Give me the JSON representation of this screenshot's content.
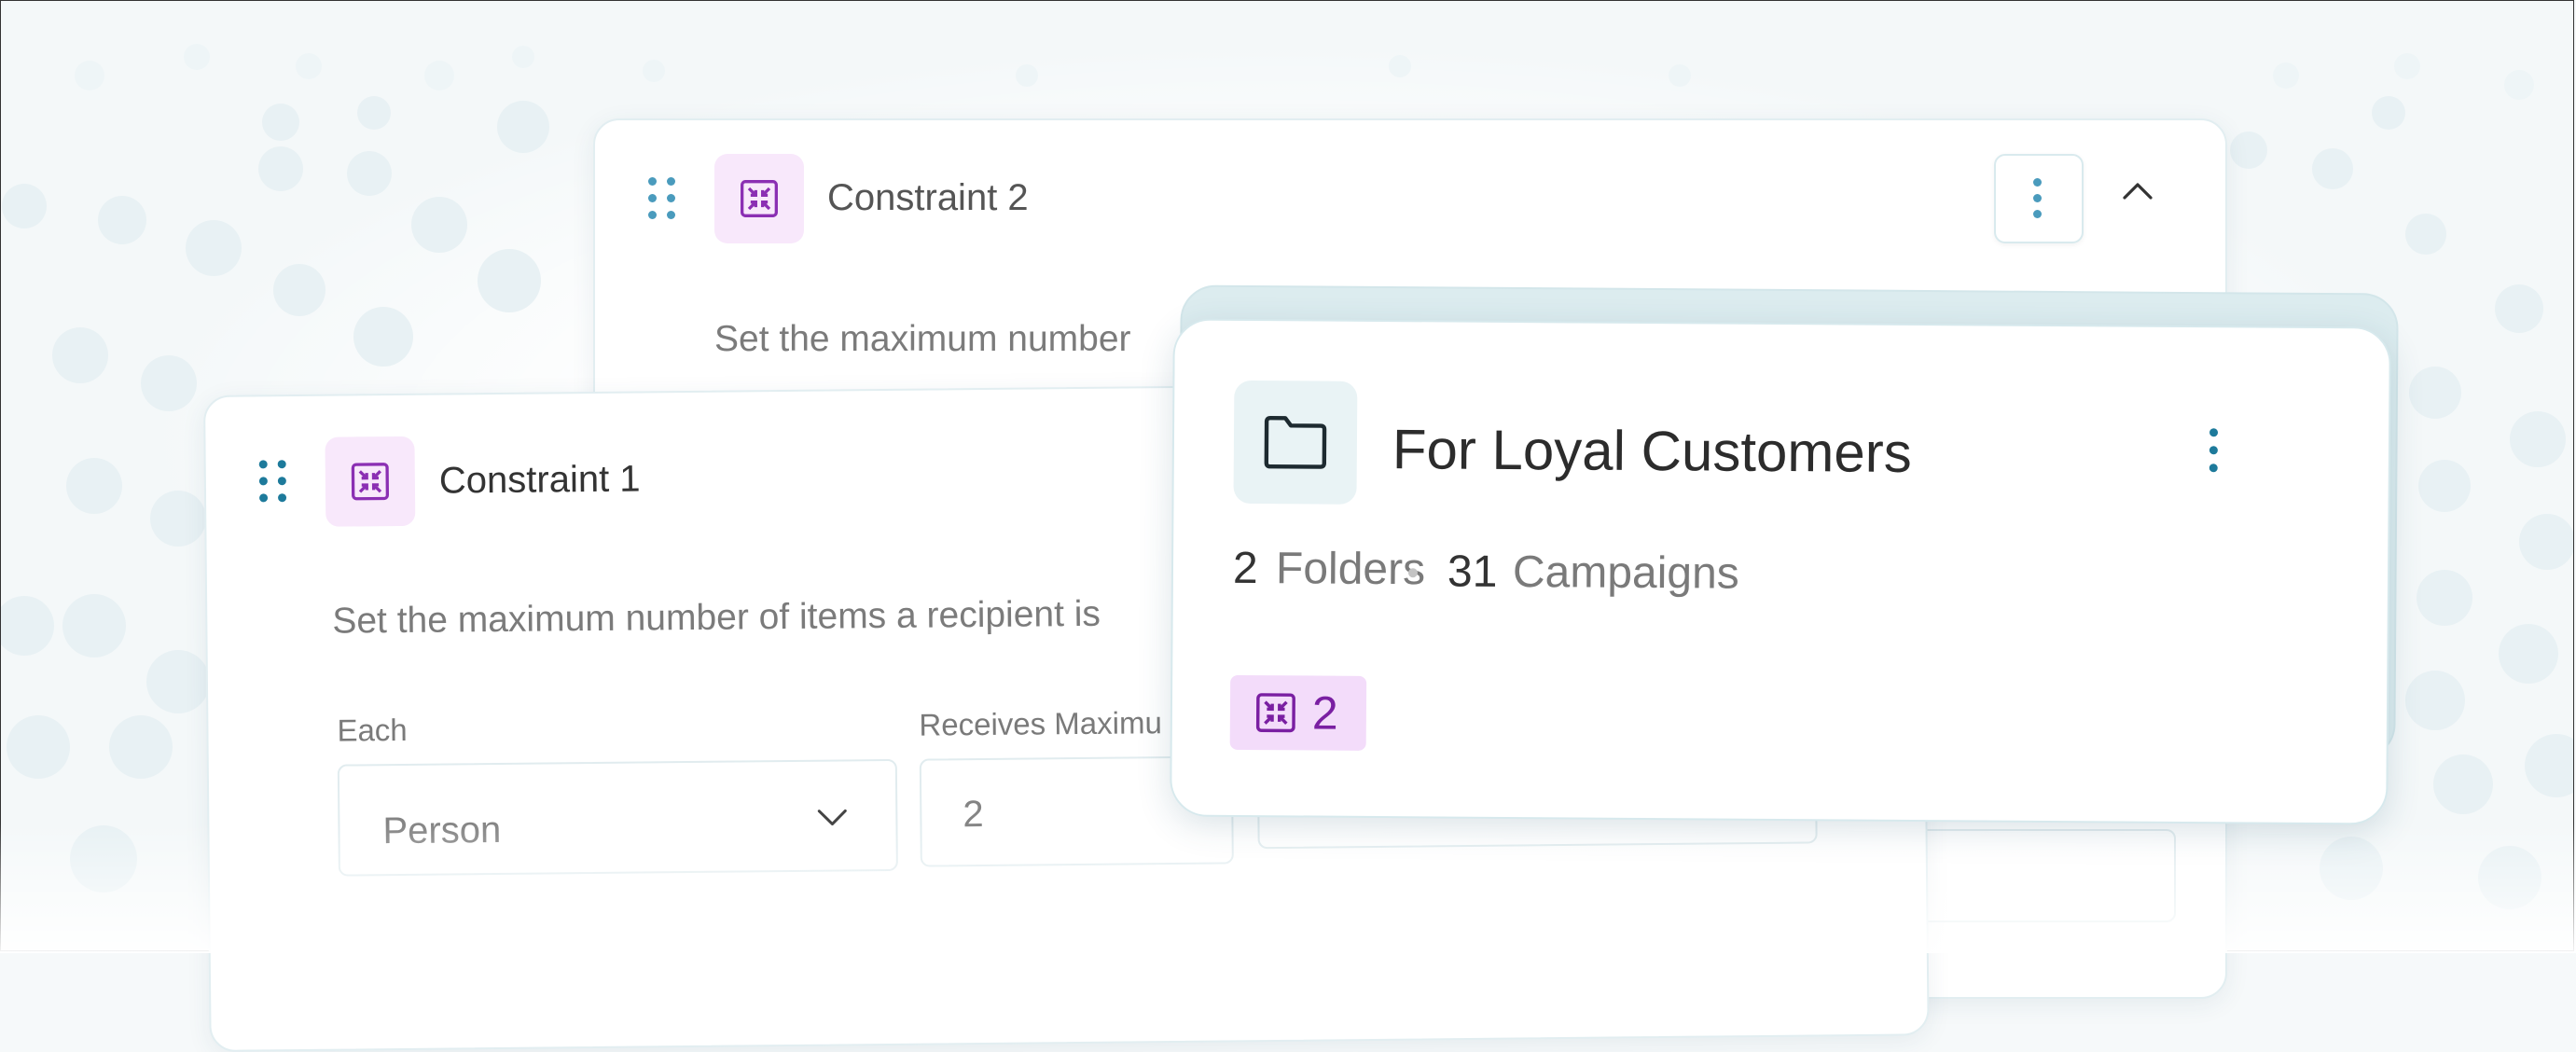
{
  "constraint2": {
    "title": "Constraint 2",
    "description": "Set the maximum number",
    "actions": {
      "more_icon": "kebab-vertical-icon",
      "collapse_icon": "chevron-up-icon"
    }
  },
  "constraint1": {
    "title": "Constraint 1",
    "description": "Set the maximum number of items a recipient is",
    "fields": {
      "each_label": "Each",
      "each_value": "Person",
      "receives_label": "Receives Maximu",
      "receives_value": "2"
    }
  },
  "folder_card": {
    "title": "For Loyal Customers",
    "folders_count": "2",
    "folders_label": "Folders",
    "campaigns_count": "31",
    "campaigns_label": "Campaigns",
    "constraint_badge_count": "2",
    "icons": {
      "folder": "folder-icon",
      "more": "kebab-vertical-icon",
      "badge": "constraint-icon"
    }
  },
  "colors": {
    "accent_teal": "#1d7a9b",
    "constraint_purple": "#8b2fb3",
    "constraint_tile_bg": "#f8e8fb",
    "badge_bg": "#f3dcfa"
  }
}
